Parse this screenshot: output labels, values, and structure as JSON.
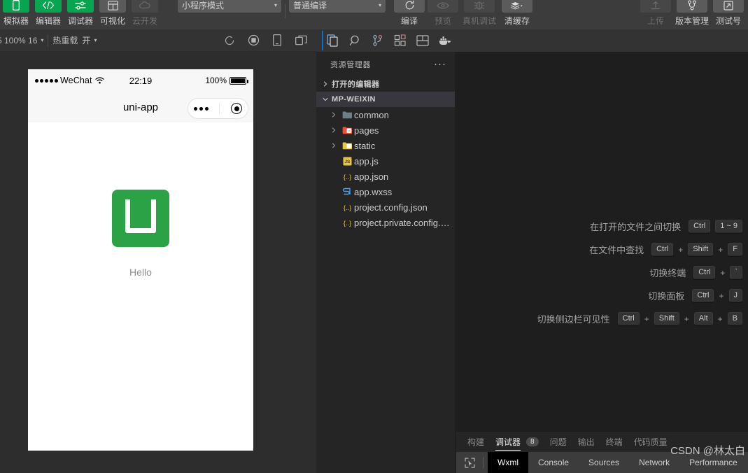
{
  "toolbar": {
    "mode_buttons": [
      {
        "label": "模拟器",
        "icon": "phone-icon",
        "state": "green"
      },
      {
        "label": "编辑器",
        "icon": "code-icon",
        "state": "green"
      },
      {
        "label": "调试器",
        "icon": "debugger-icon",
        "state": "green"
      },
      {
        "label": "可视化",
        "icon": "layout-icon",
        "state": "grey"
      },
      {
        "label": "云开发",
        "icon": "cloud-icon",
        "state": "dim"
      }
    ],
    "mode_select": {
      "value": "小程序模式",
      "caret": "▾"
    },
    "compile_select": {
      "value": "普通编译",
      "caret": "▾"
    },
    "actions": [
      {
        "label": "编译",
        "icon": "refresh-icon",
        "state": "grey"
      },
      {
        "label": "预览",
        "icon": "eye-icon",
        "state": "dim"
      },
      {
        "label": "真机调试",
        "icon": "bug-icon",
        "state": "dim"
      },
      {
        "label": "清缓存",
        "icon": "layers-icon",
        "state": "grey",
        "caret": "▾"
      }
    ],
    "right_actions": [
      {
        "label": "上传",
        "icon": "upload-icon",
        "state": "dim"
      },
      {
        "label": "版本管理",
        "icon": "branch-icon",
        "state": "grey"
      },
      {
        "label": "测试号",
        "icon": "external-link-icon",
        "state": "grey"
      }
    ]
  },
  "subbar": {
    "device_select": {
      "value": "5 100% 16",
      "caret": "▾"
    },
    "hotreload": {
      "label": "热重载",
      "value": "开",
      "caret": "▾"
    },
    "icons": [
      {
        "name": "refresh-circle-icon"
      },
      {
        "name": "record-icon"
      },
      {
        "name": "device-icon"
      },
      {
        "name": "multi-window-icon"
      }
    ]
  },
  "simulator": {
    "status": {
      "carrier": "WeChat",
      "time": "22:19",
      "battery_percent": "100%"
    },
    "nav_title": "uni-app",
    "page": {
      "logo_alt": "uni-app-logo",
      "hello": "Hello"
    }
  },
  "editor": {
    "activity_icons": [
      {
        "name": "explorer-icon",
        "active": true
      },
      {
        "name": "search-icon",
        "active": false
      },
      {
        "name": "source-control-icon",
        "active": false
      },
      {
        "name": "extensions-icon",
        "active": false
      },
      {
        "name": "layout-panel-icon",
        "active": false
      },
      {
        "name": "docker-icon",
        "active": false
      }
    ],
    "sidebar": {
      "title": "资源管理器",
      "more": "···",
      "sections": [
        {
          "label": "打开的编辑器",
          "expanded": false,
          "type": "section"
        },
        {
          "label": "MP-WEIXIN",
          "expanded": true,
          "type": "section",
          "selected": true
        }
      ],
      "files": [
        {
          "label": "common",
          "type": "folder",
          "icon": "folder-icon",
          "color": "#6d8086",
          "indent": 2,
          "arrow": true
        },
        {
          "label": "pages",
          "type": "folder",
          "icon": "folder-pages-icon",
          "color": "#f05133",
          "indent": 2,
          "arrow": true
        },
        {
          "label": "static",
          "type": "folder",
          "icon": "folder-static-icon",
          "color": "#e8c547",
          "indent": 2,
          "arrow": true
        },
        {
          "label": "app.js",
          "type": "file",
          "icon": "js-icon",
          "color": "#e8c547",
          "indent": 2,
          "arrow": false
        },
        {
          "label": "app.json",
          "type": "file",
          "icon": "json-icon",
          "color": "#e8c547",
          "indent": 2,
          "arrow": false
        },
        {
          "label": "app.wxss",
          "type": "file",
          "icon": "css-icon",
          "color": "#42a5f5",
          "indent": 2,
          "arrow": false
        },
        {
          "label": "project.config.json",
          "type": "file",
          "icon": "json-icon",
          "color": "#e8c547",
          "indent": 2,
          "arrow": false
        },
        {
          "label": "project.private.config.js...",
          "type": "file",
          "icon": "json-icon",
          "color": "#e8c547",
          "indent": 2,
          "arrow": false
        }
      ]
    },
    "shortcuts": [
      {
        "label": "在打开的文件之间切换",
        "keys": [
          "Ctrl",
          "1 ~ 9"
        ],
        "seps": [
          ""
        ]
      },
      {
        "label": "在文件中查找",
        "keys": [
          "Ctrl",
          "Shift",
          "F"
        ],
        "seps": [
          "+",
          "+"
        ]
      },
      {
        "label": "切换终端",
        "keys": [
          "Ctrl",
          "`"
        ],
        "seps": [
          "+"
        ]
      },
      {
        "label": "切换面板",
        "keys": [
          "Ctrl",
          "J"
        ],
        "seps": [
          "+"
        ]
      },
      {
        "label": "切换侧边栏可见性",
        "keys": [
          "Ctrl",
          "Shift",
          "Alt",
          "B"
        ],
        "seps": [
          "+",
          "+",
          "+"
        ]
      }
    ]
  },
  "panel": {
    "tabs": [
      {
        "label": "构建",
        "active": false
      },
      {
        "label": "调试器",
        "active": true,
        "badge": "8"
      },
      {
        "label": "问题",
        "active": false
      },
      {
        "label": "输出",
        "active": false
      },
      {
        "label": "终端",
        "active": false
      },
      {
        "label": "代码质量",
        "active": false
      }
    ],
    "devtools_tabs": [
      {
        "label": "Wxml",
        "active": true
      },
      {
        "label": "Console",
        "active": false
      },
      {
        "label": "Sources",
        "active": false
      },
      {
        "label": "Network",
        "active": false
      },
      {
        "label": "Performance",
        "active": false
      }
    ],
    "inspect_icon": "inspect-element-icon"
  },
  "watermark": "CSDN @林太白",
  "colors": {
    "accent_green": "#07a54f",
    "logo_green": "#2ba245",
    "editor_bg": "#1e1e1e",
    "sidebar_bg": "#252526",
    "toolbar_bg": "#3c3c3c",
    "selection": "#37373d",
    "active_blue": "#0e73c8"
  }
}
